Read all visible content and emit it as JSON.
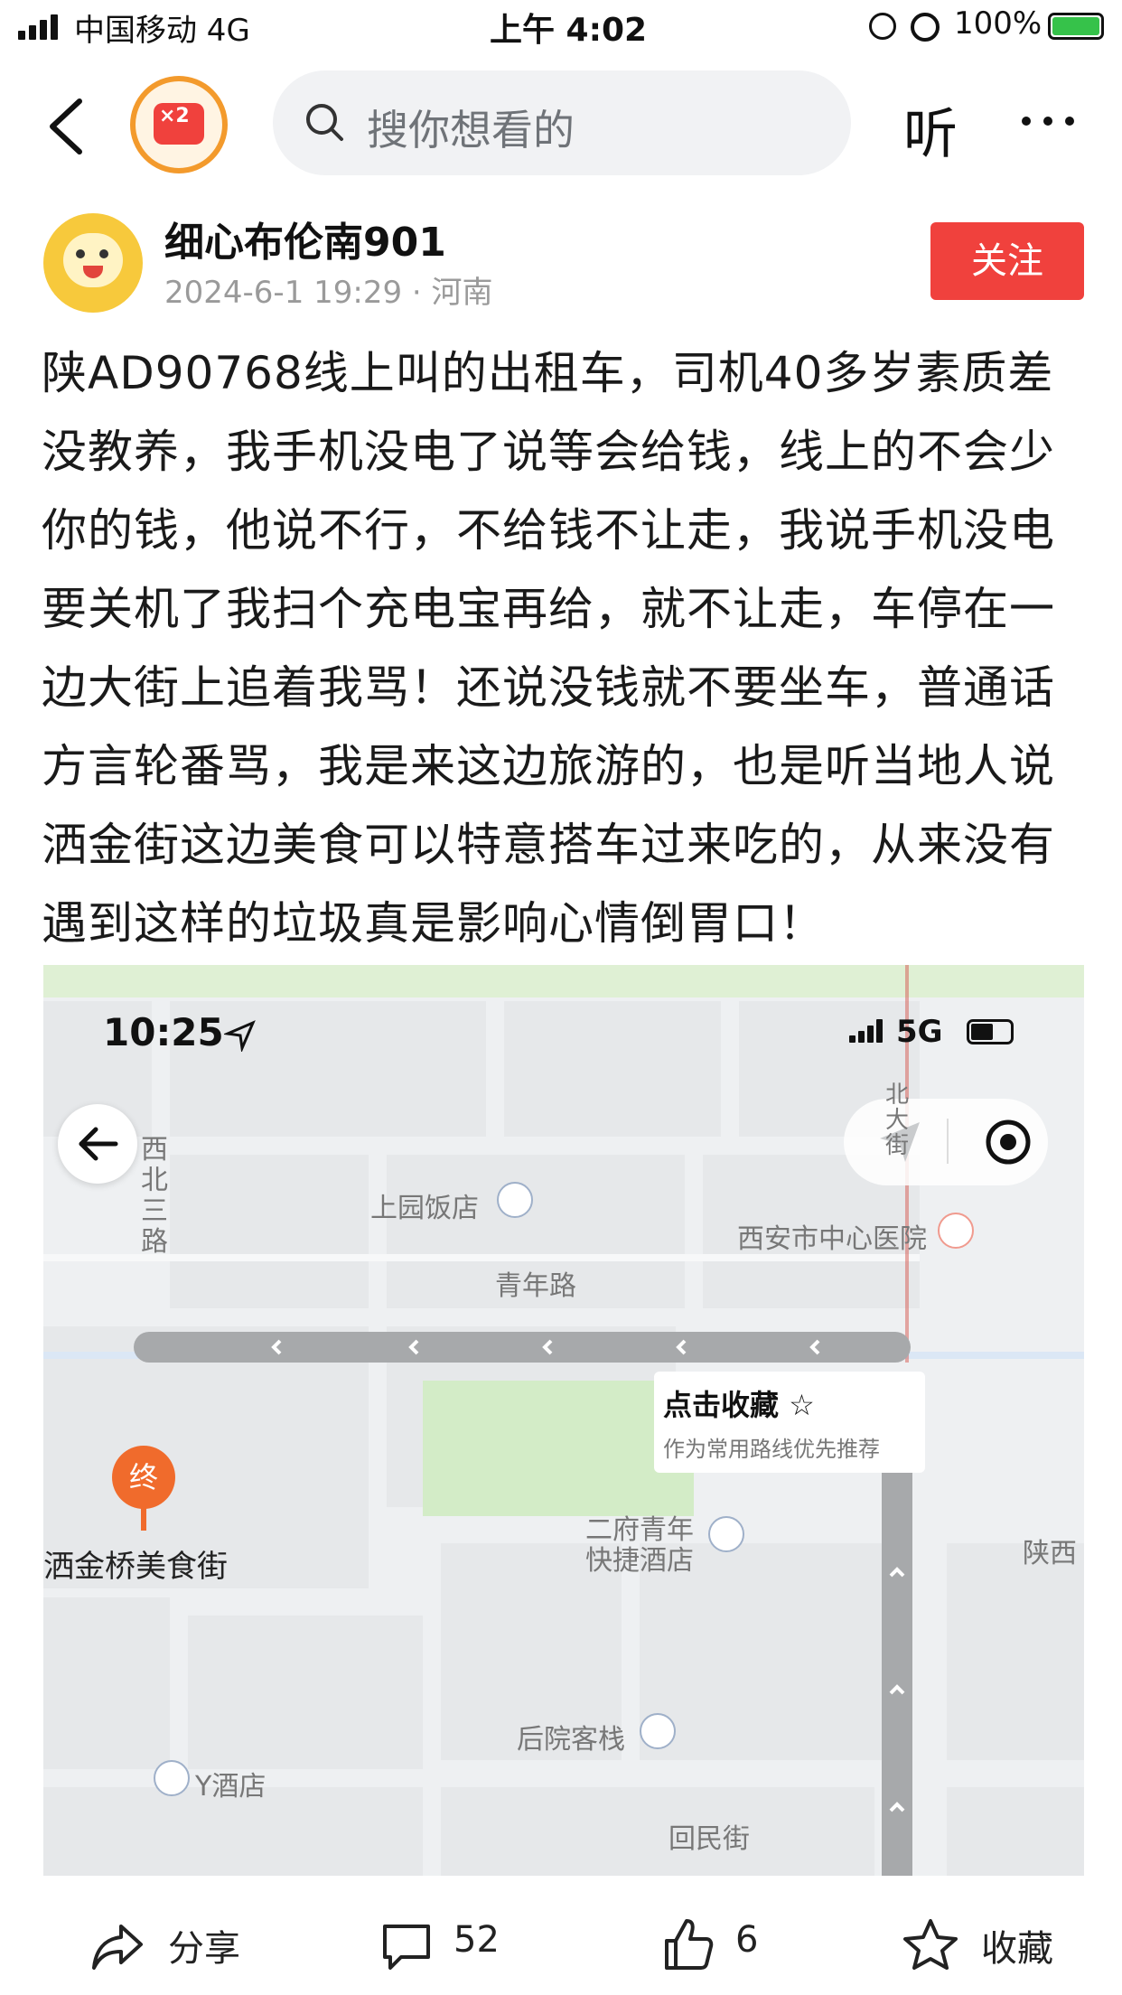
{
  "status_bar": {
    "carrier": "中国移动   4G",
    "time": "上午 4:02",
    "battery": "100%"
  },
  "nav": {
    "search_placeholder": "搜你想看的",
    "listen_label": "听",
    "badge_text": "×2"
  },
  "author": {
    "name": "细心布伦南901",
    "meta": "2024-6-1 19:29 · 河南",
    "follow_label": "关注"
  },
  "post": {
    "text": "陕AD90768线上叫的出租车，司机40多岁素质差没教养，我手机没电了说等会给钱，线上的不会少你的钱，他说不行，不给钱不让走，我说手机没电要关机了我扫个充电宝再给，就不让走，车停在一边大街上追着我骂！还说没钱就不要坐车，普通话方言轮番骂，我是来这边旅游的，也是听当地人说洒金街这边美食可以特意搭车过来吃的，从来没有遇到这样的垃圾真是影响心情倒胃口！"
  },
  "map_screenshot": {
    "time": "10:25",
    "network": "5G",
    "labels": {
      "road_xibeisanlu": "西北三路",
      "shangyuan": "上园饭店",
      "xian_hospital": "西安市中心医院",
      "qingnianlu": "青年路",
      "beidajie": "北大街",
      "save_title": "点击收藏 ☆",
      "save_sub": "作为常用路线优先推荐",
      "end_marker": "终",
      "destination": "洒金桥美食街",
      "erfu_hotel_1": "二府青年",
      "erfu_hotel_2": "快捷酒店",
      "shaanxi": "陕西",
      "houyuan": "后院客栈",
      "y_hotel": "Y酒店",
      "huiminjie": "回民街"
    }
  },
  "actions": {
    "share": "分享",
    "comments": "52",
    "likes": "6",
    "favorite": "收藏"
  },
  "colors": {
    "accent": "#f0413d",
    "route": "#a7a9ab",
    "marker": "#f06b2c"
  }
}
